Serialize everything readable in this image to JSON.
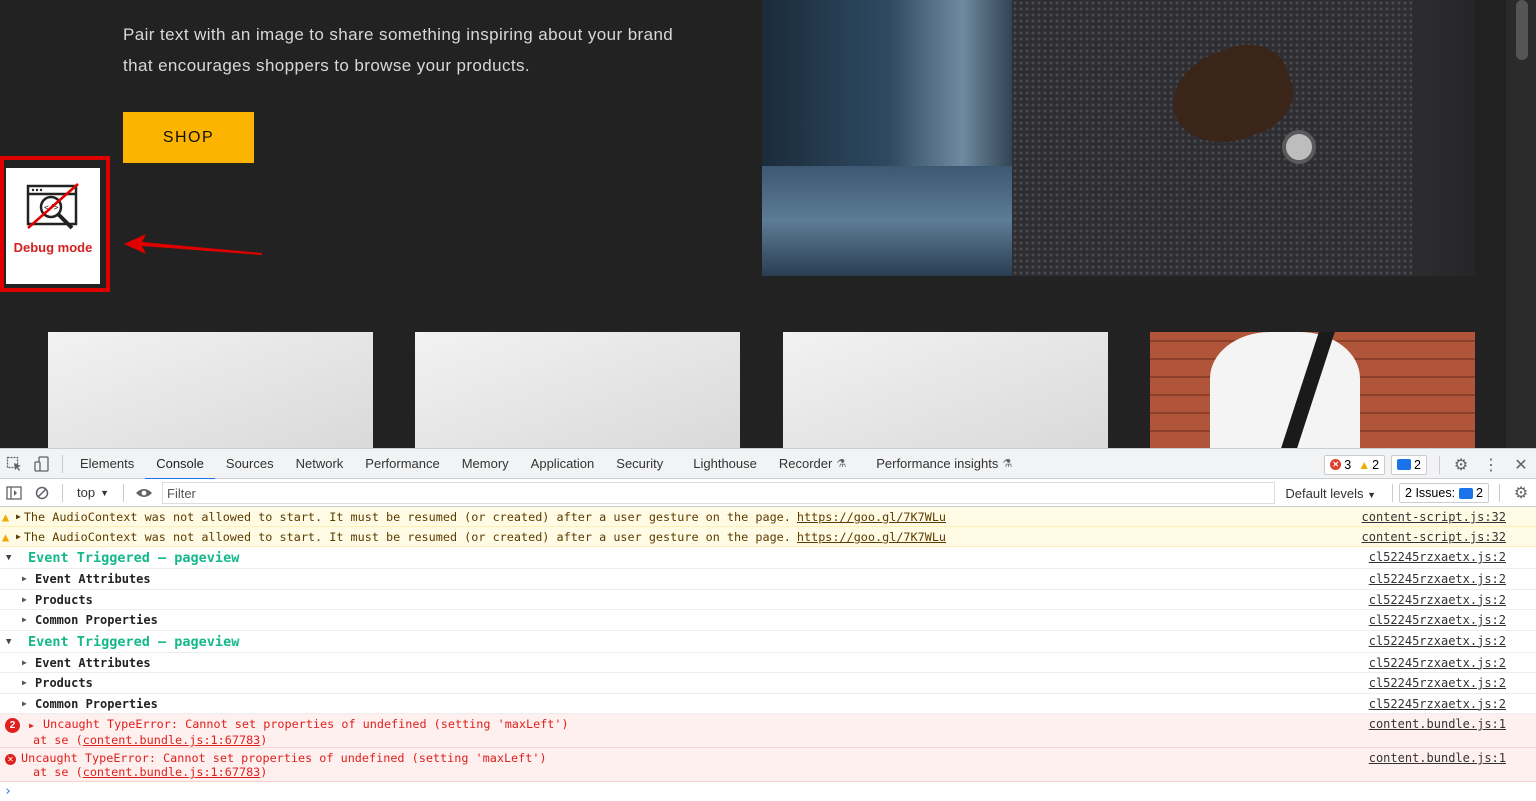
{
  "site": {
    "hero_text": "Pair text with an image to share something inspiring about your brand that encourages shoppers to browse your products.",
    "shop_label": "SHOP",
    "debug_label": "Debug mode"
  },
  "devtools": {
    "tabs": [
      "Elements",
      "Console",
      "Sources",
      "Network",
      "Performance",
      "Memory",
      "Application",
      "Security",
      "Lighthouse",
      "Recorder",
      "Performance insights"
    ],
    "active_tab": "Console",
    "error_count": "3",
    "warning_count": "2",
    "message_count": "2",
    "context": "top",
    "filter_placeholder": "Filter",
    "levels_label": "Default levels",
    "issues_label": "2 Issues:",
    "issues_count": "2",
    "logs": {
      "warn1": {
        "text": "The AudioContext was not allowed to start. It must be resumed (or created) after a user gesture on the page.",
        "link": "https://goo.gl/7K7WLu",
        "source": "content-script.js:32"
      },
      "warn2": {
        "text": "The AudioContext was not allowed to start. It must be resumed (or created) after a user gesture on the page.",
        "link": "https://goo.gl/7K7WLu",
        "source": "content-script.js:32"
      },
      "group1": {
        "title": "Event Triggered – pageview",
        "source": "cl52245rzxaetx.js:2"
      },
      "group1_children": [
        {
          "label": "Event Attributes",
          "source": "cl52245rzxaetx.js:2"
        },
        {
          "label": "Products",
          "source": "cl52245rzxaetx.js:2"
        },
        {
          "label": "Common Properties",
          "source": "cl52245rzxaetx.js:2"
        }
      ],
      "group2": {
        "title": "Event Triggered – pageview",
        "source": "cl52245rzxaetx.js:2"
      },
      "group2_children": [
        {
          "label": "Event Attributes",
          "source": "cl52245rzxaetx.js:2"
        },
        {
          "label": "Products",
          "source": "cl52245rzxaetx.js:2"
        },
        {
          "label": "Common Properties",
          "source": "cl52245rzxaetx.js:2"
        }
      ],
      "error1": {
        "count": "2",
        "text": "Uncaught TypeError: Cannot set properties of undefined (setting 'maxLeft')",
        "at": "at se (",
        "at_link": "content.bundle.js:1:67783",
        "at_end": ")",
        "source": "content.bundle.js:1"
      },
      "error2": {
        "text": "Uncaught TypeError: Cannot set properties of undefined (setting 'maxLeft')",
        "at": "at se (",
        "at_link": "content.bundle.js:1:67783",
        "at_end": ")",
        "source": "content.bundle.js:1"
      }
    }
  }
}
